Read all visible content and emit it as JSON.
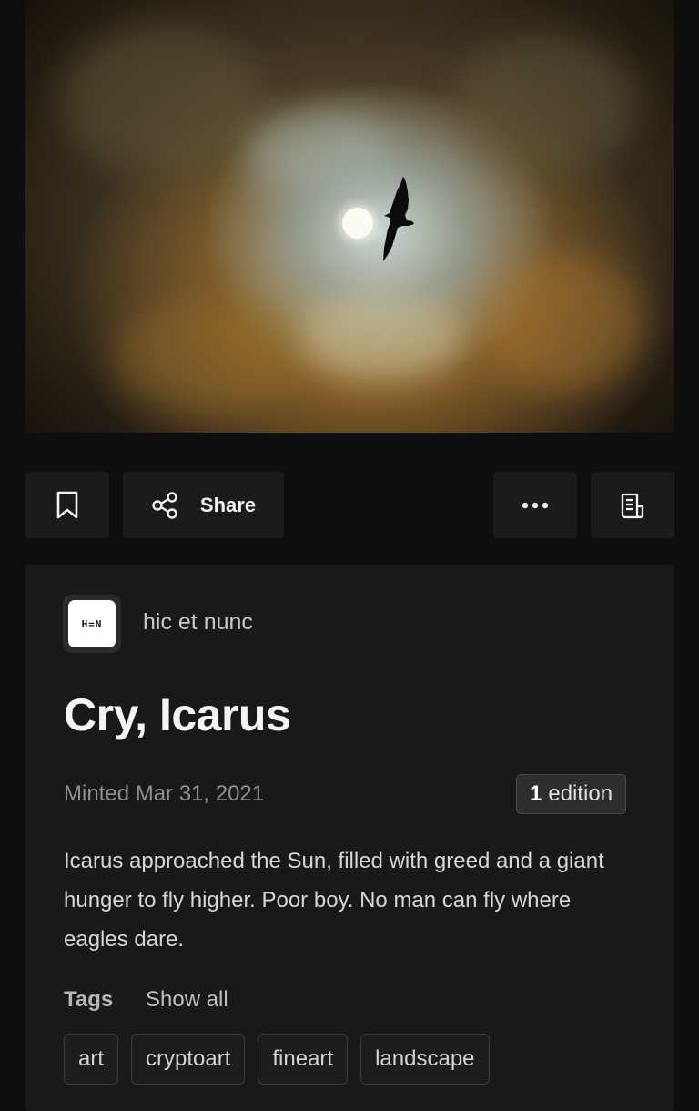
{
  "toolbar": {
    "share_label": "Share"
  },
  "artwork": {
    "icon": "eagle-and-sun-photo"
  },
  "details": {
    "platform_logo_text": "H=N",
    "creator": "hic et nunc",
    "title": "Cry, Icarus",
    "minted": "Minted Mar 31, 2021",
    "edition_count": "1",
    "edition_label": "edition",
    "description": "Icarus approached the Sun, filled with greed and a giant hunger to fly higher. Poor boy. No man can fly where eagles dare.",
    "tags_label": "Tags",
    "show_all_label": "Show all",
    "tags": [
      "art",
      "cryptoart",
      "fineart",
      "landscape"
    ]
  },
  "icons": {
    "bookmark": "bookmark-icon",
    "share": "share-icon",
    "more": "more-icon",
    "details": "document-icon"
  },
  "colors": {
    "background": "#0e0e0e",
    "card": "#191919",
    "button": "#1b1b1b"
  }
}
